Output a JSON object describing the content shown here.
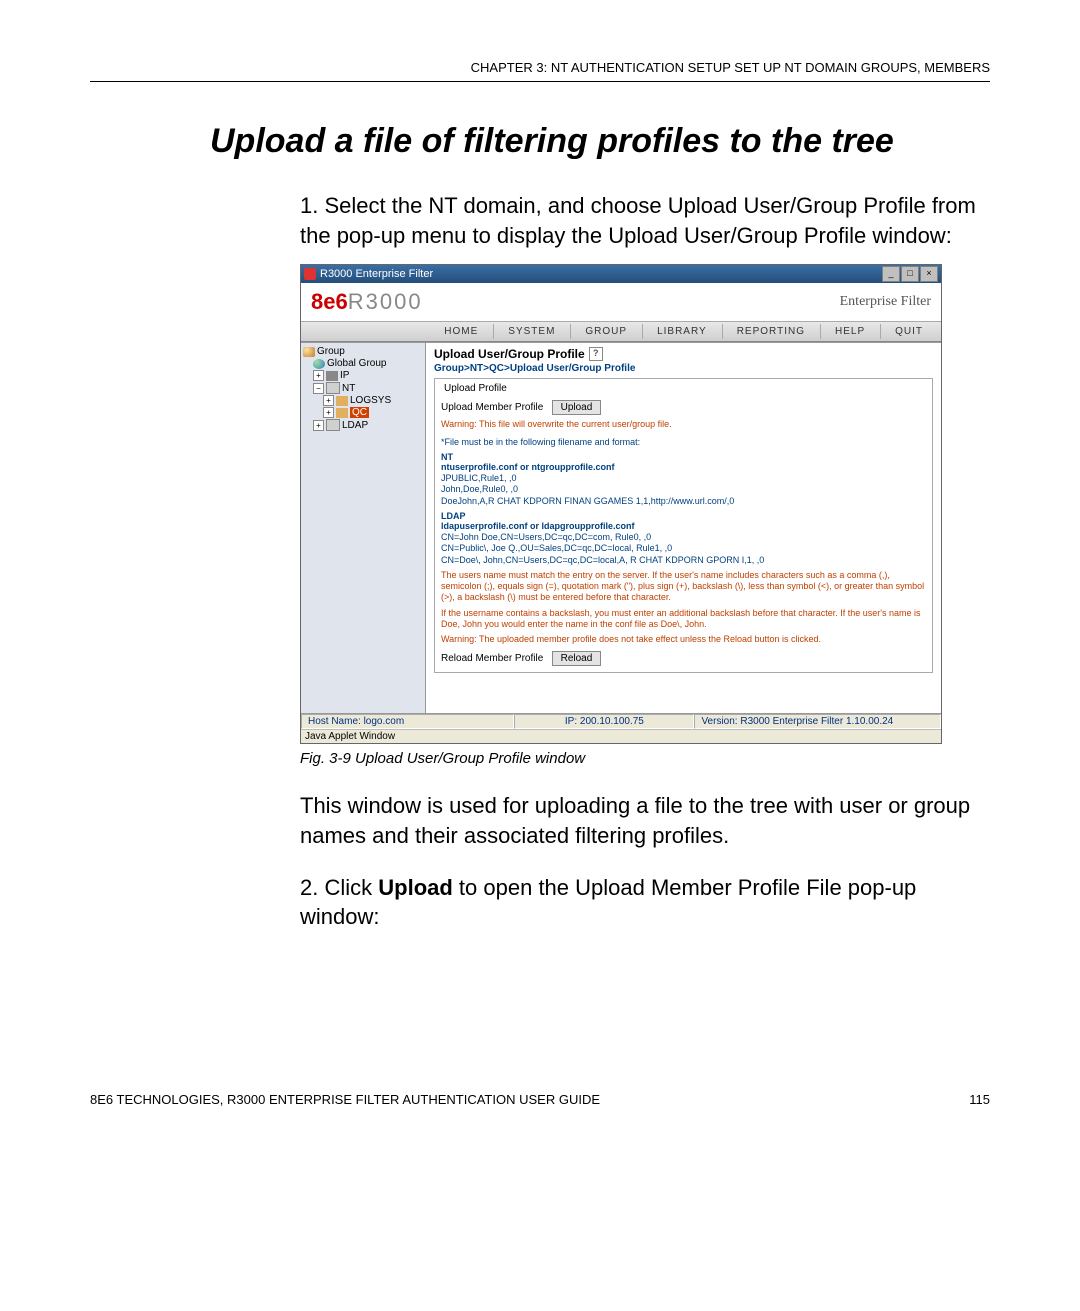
{
  "running_head": "CHAPTER 3: NT AUTHENTICATION SETUP   SET UP NT DOMAIN GROUPS, MEMBERS",
  "section_title": "Upload a file of filtering profiles to the tree",
  "step1": "1. Select the NT domain, and choose Upload User/Group Profile from the pop-up menu to display the Upload User/Group Profile window:",
  "fig_caption": "Fig. 3-9  Upload User/Group Profile window",
  "para_after_fig": "This window is used for uploading a file to the tree with user or group names and their associated filtering profiles.",
  "step2_prefix": "2. Click ",
  "step2_bold": "Upload",
  "step2_suffix": " to open the Upload Member Profile File pop-up window:",
  "footer_left": "8E6 TECHNOLOGIES, R3000 ENTERPRISE FILTER AUTHENTICATION USER GUIDE",
  "footer_right": "115",
  "window": {
    "title": "R3000 Enterprise Filter",
    "brand_logo_bold": "8e6",
    "brand_logo_gray": "R3000",
    "brand_sub": "Enterprise Filter",
    "menu": [
      "HOME",
      "SYSTEM",
      "GROUP",
      "LIBRARY",
      "REPORTING",
      "HELP",
      "QUIT"
    ],
    "tree": {
      "root": "Group",
      "global": "Global Group",
      "ip": "IP",
      "nt": "NT",
      "logsys": "LOGSYS",
      "qc": "QC",
      "ldap": "LDAP"
    },
    "panel": {
      "title": "Upload User/Group Profile",
      "breadcrumb": "Group>NT>QC>Upload User/Group Profile",
      "fieldset_legend": "Upload Profile",
      "upload_label": "Upload Member Profile",
      "upload_btn": "Upload",
      "warn1": "Warning: This file will overwrite the current user/group file.",
      "file_format_note": "*File must be in the following filename and format:",
      "nt_hdr": "NT",
      "nt_line1": "ntuserprofile.conf or ntgroupprofile.conf",
      "nt_line2": "JPUBLIC,Rule1, ,0",
      "nt_line3": "John,Doe,Rule0, ,0",
      "nt_line4": "DoeJohn,A,R CHAT KDPORN FINAN GGAMES 1,1,http://www.url.com/,0",
      "ldap_hdr": "LDAP",
      "ldap_line1": "ldapuserprofile.conf or ldapgroupprofile.conf",
      "ldap_line2": "CN=John Doe,CN=Users,DC=qc,DC=com, Rule0, ,0",
      "ldap_line3": "CN=Public\\, Joe Q.,OU=Sales,DC=qc,DC=local, Rule1, ,0",
      "ldap_line4": "CN=Doe\\, John,CN=Users,DC=qc,DC=local,A, R CHAT KDPORN GPORN I,1, ,0",
      "rules_para": "The users name must match the entry on the server. If the user's name includes characters such as a comma (,), semicolon (;), equals sign (=), quotation mark (\"), plus sign (+), backslash (\\), less than symbol (<), or greater than symbol (>), a backslash (\\) must be entered before that character.",
      "backslash_para": "If the username contains a backslash, you must enter an additional backslash before that character. If the user's name is Doe, John you would enter the name in the conf file as Doe\\, John.",
      "warn2": "Warning: The uploaded member profile does not take effect unless the Reload button is clicked.",
      "reload_label": "Reload Member Profile",
      "reload_btn": "Reload"
    },
    "status": {
      "host": "Host Name: logo.com",
      "ip": "IP: 200.10.100.75",
      "version": "Version: R3000 Enterprise Filter 1.10.00.24"
    },
    "applet": "Java Applet Window"
  }
}
